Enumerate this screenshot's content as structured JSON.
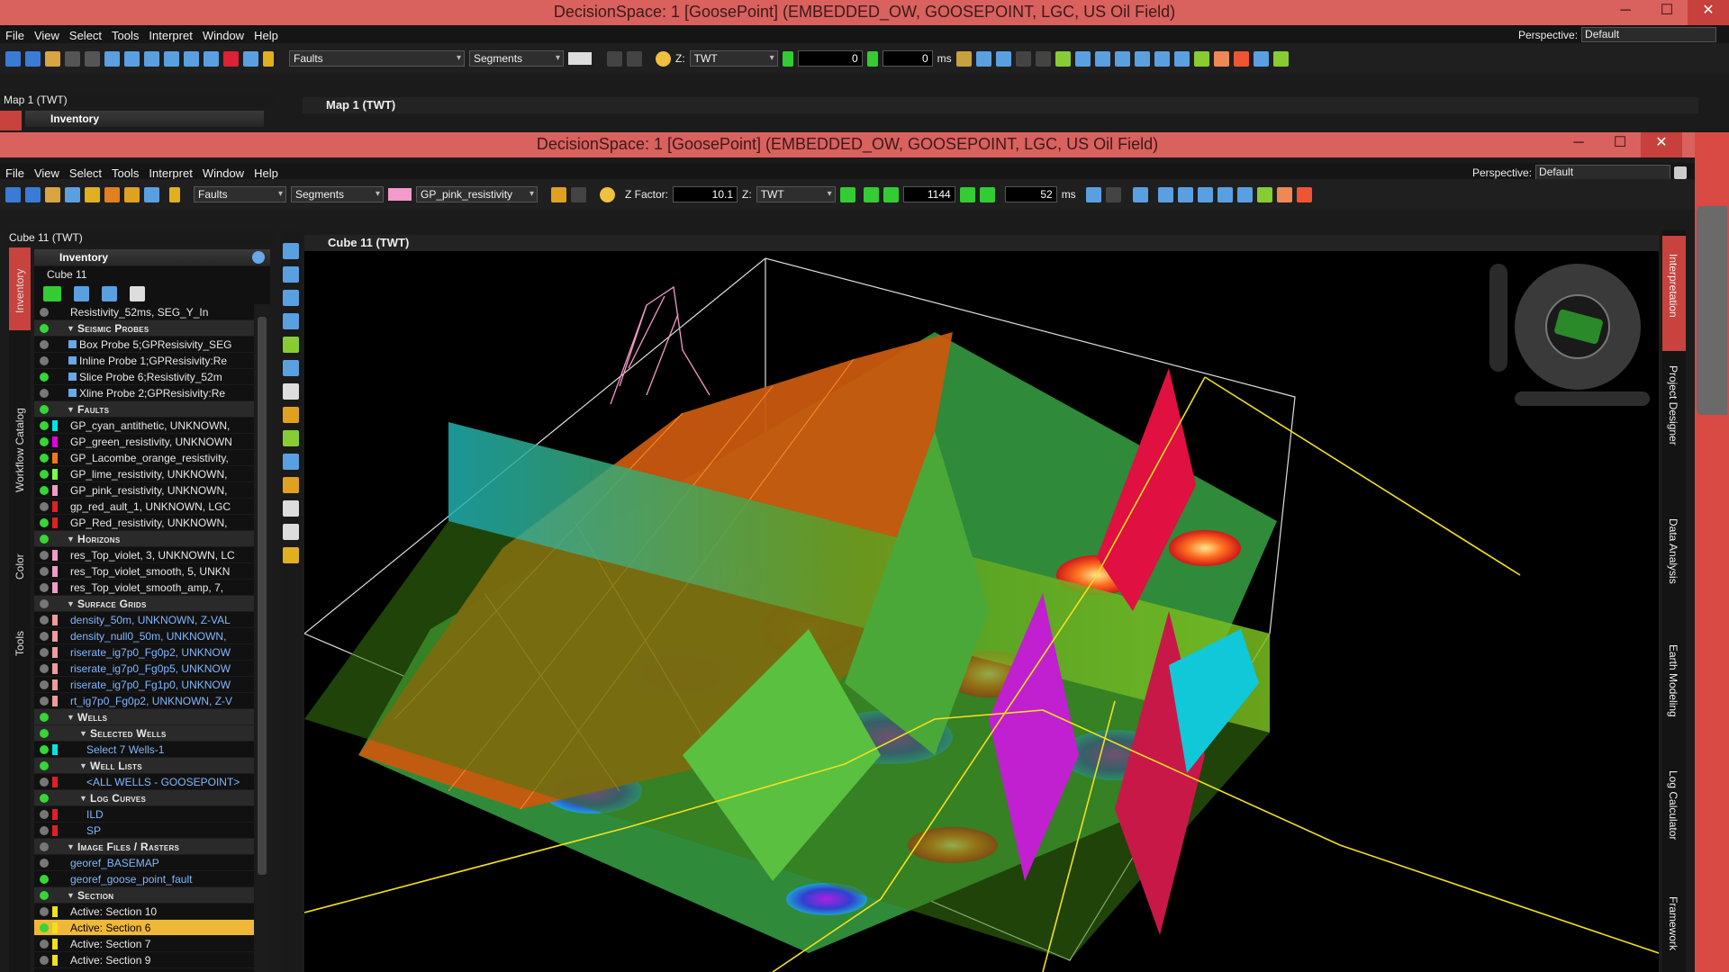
{
  "back_window": {
    "title": "DecisionSpace: 1 [GoosePoint] (EMBEDDED_OW, GOOSEPOINT, LGC, US Oil Field)",
    "menu": [
      "File",
      "View",
      "Select",
      "Tools",
      "Interpret",
      "Window",
      "Help"
    ],
    "perspective_label": "Perspective:",
    "perspective_value": "Default",
    "toolbar": {
      "faults": "Faults",
      "segments": "Segments",
      "z_label": "Z:",
      "z_domain": "TWT",
      "frame": "0",
      "ms_value": "0",
      "ms_unit": "ms"
    },
    "left_panel_title": "Map 1 (TWT)",
    "inventory_label": "Inventory",
    "view_title": "Map 1 (TWT)"
  },
  "front_window": {
    "title": "DecisionSpace: 1 [GoosePoint] (EMBEDDED_OW, GOOSEPOINT, LGC, US Oil Field)",
    "menu": [
      "File",
      "View",
      "Select",
      "Tools",
      "Interpret",
      "Window",
      "Help"
    ],
    "perspective_label": "Perspective:",
    "perspective_value": "Default",
    "toolbar": {
      "faults": "Faults",
      "segments": "Segments",
      "fault_name": "GP_pink_resistivity",
      "z_factor_label": "Z Factor:",
      "z_factor": "10.1",
      "z_label": "Z:",
      "z_domain": "TWT",
      "frame": "1144",
      "step": "52",
      "step_unit": "ms",
      "fault_color": "#f29ac9"
    },
    "left_panel_title": "Cube 11 (TWT)",
    "inventory_label": "Inventory",
    "tree_root": "Cube 11",
    "view_title": "Cube 11 (TWT)",
    "side_tabs": [
      "Inventory",
      "Workflow Catalog",
      "Color",
      "Tools"
    ],
    "right_tabs": [
      "Interpretation",
      "Project Designer",
      "Data Analysis",
      "Earth Modeling",
      "Log Calculator",
      "Framework"
    ]
  },
  "tree": [
    {
      "kind": "item",
      "text": "Resistivity_52ms, SEG_Y_In",
      "color": "",
      "on": false,
      "blue": false
    },
    {
      "kind": "cat",
      "text": "Seismic Probes",
      "on": true
    },
    {
      "kind": "item",
      "text": "Box Probe 5;GPResisivity_SEG",
      "color": "",
      "on": false,
      "icon": true
    },
    {
      "kind": "item",
      "text": "Inline Probe 1;GPResisivity:Re",
      "color": "",
      "on": false,
      "icon": true
    },
    {
      "kind": "item",
      "text": "Slice Probe 6;Resistivity_52m",
      "color": "",
      "on": true,
      "icon": true
    },
    {
      "kind": "item",
      "text": "Xline Probe 2;GPResisivity:Re",
      "color": "",
      "on": false,
      "icon": true
    },
    {
      "kind": "cat",
      "text": "Faults",
      "on": true
    },
    {
      "kind": "item",
      "text": "GP_cyan_antithetic, UNKNOWN,",
      "color": "#00e5e5",
      "on": true
    },
    {
      "kind": "item",
      "text": "GP_green_resistivity, UNKNOWN",
      "color": "#e000e0",
      "on": true
    },
    {
      "kind": "item",
      "text": "GP_Lacombe_orange_resistivity,",
      "color": "#f07820",
      "on": true
    },
    {
      "kind": "item",
      "text": "GP_lime_resistivity, UNKNOWN,",
      "color": "#7cff4a",
      "on": true
    },
    {
      "kind": "item",
      "text": "GP_pink_resistivity, UNKNOWN,",
      "color": "#f29ac9",
      "on": true
    },
    {
      "kind": "item",
      "text": "gp_red_ault_1, UNKNOWN, LGC",
      "color": "#e02020",
      "on": false
    },
    {
      "kind": "item",
      "text": "GP_Red_resistivity, UNKNOWN,",
      "color": "#e02020",
      "on": true
    },
    {
      "kind": "cat",
      "text": "Horizons",
      "on": true
    },
    {
      "kind": "item",
      "text": "res_Top_violet, 3, UNKNOWN, LC",
      "color": "#f29ac9",
      "on": false
    },
    {
      "kind": "item",
      "text": "res_Top_violet_smooth, 5, UNKN",
      "color": "#f29ac9",
      "on": false
    },
    {
      "kind": "item",
      "text": "res_Top_violet_smooth_amp, 7,",
      "color": "#f29ac9",
      "on": false
    },
    {
      "kind": "cat",
      "text": "Surface Grids",
      "on": false
    },
    {
      "kind": "item",
      "text": "density_50m, UNKNOWN, Z-VAL",
      "color": "#f29a9a",
      "on": false,
      "blue": true
    },
    {
      "kind": "item",
      "text": "density_null0_50m, UNKNOWN,",
      "color": "#f29a9a",
      "on": false,
      "blue": true
    },
    {
      "kind": "item",
      "text": "riserate_ig7p0_Fg0p2, UNKNOW",
      "color": "#f29a9a",
      "on": false,
      "blue": true
    },
    {
      "kind": "item",
      "text": "riserate_ig7p0_Fg0p5, UNKNOW",
      "color": "#f29a9a",
      "on": false,
      "blue": true
    },
    {
      "kind": "item",
      "text": "riserate_ig7p0_Fg1p0, UNKNOW",
      "color": "#f29a9a",
      "on": false,
      "blue": true
    },
    {
      "kind": "item",
      "text": "rt_ig7p0_Fg0p2, UNKNOWN, Z-V",
      "color": "#f29a9a",
      "on": false,
      "blue": true
    },
    {
      "kind": "cat",
      "text": "Wells",
      "on": true
    },
    {
      "kind": "sub",
      "text": "Selected Wells",
      "on": true
    },
    {
      "kind": "item2",
      "text": "Select 7 Wells-1",
      "color": "#00e5e5",
      "on": true,
      "blue": true
    },
    {
      "kind": "sub",
      "text": "Well Lists",
      "on": true
    },
    {
      "kind": "item2",
      "text": "<ALL WELLS - GOOSEPOINT>",
      "color": "#e02020",
      "on": false,
      "blue": true
    },
    {
      "kind": "sub",
      "text": "Log Curves",
      "on": true
    },
    {
      "kind": "item2",
      "text": "ILD",
      "color": "#e02020",
      "on": false,
      "blue": true
    },
    {
      "kind": "item2",
      "text": "SP",
      "color": "#e02020",
      "on": false,
      "blue": true
    },
    {
      "kind": "cat",
      "text": "Image Files / Rasters",
      "on": false
    },
    {
      "kind": "item",
      "text": "georef_BASEMAP",
      "color": "",
      "on": false,
      "blue": true
    },
    {
      "kind": "item",
      "text": "georef_goose_point_fault",
      "color": "",
      "on": true,
      "blue": true
    },
    {
      "kind": "cat",
      "text": "Section",
      "on": true
    },
    {
      "kind": "item",
      "text": "Active: Section 10",
      "color": "#f0e020",
      "on": false
    },
    {
      "kind": "item",
      "text": "Active: Section 6",
      "color": "#f0e020",
      "on": true,
      "selected": true
    },
    {
      "kind": "item",
      "text": "Active: Section 7",
      "color": "#f0e020",
      "on": false
    },
    {
      "kind": "item",
      "text": "Active: Section 9",
      "color": "#f0e020",
      "on": false
    }
  ]
}
